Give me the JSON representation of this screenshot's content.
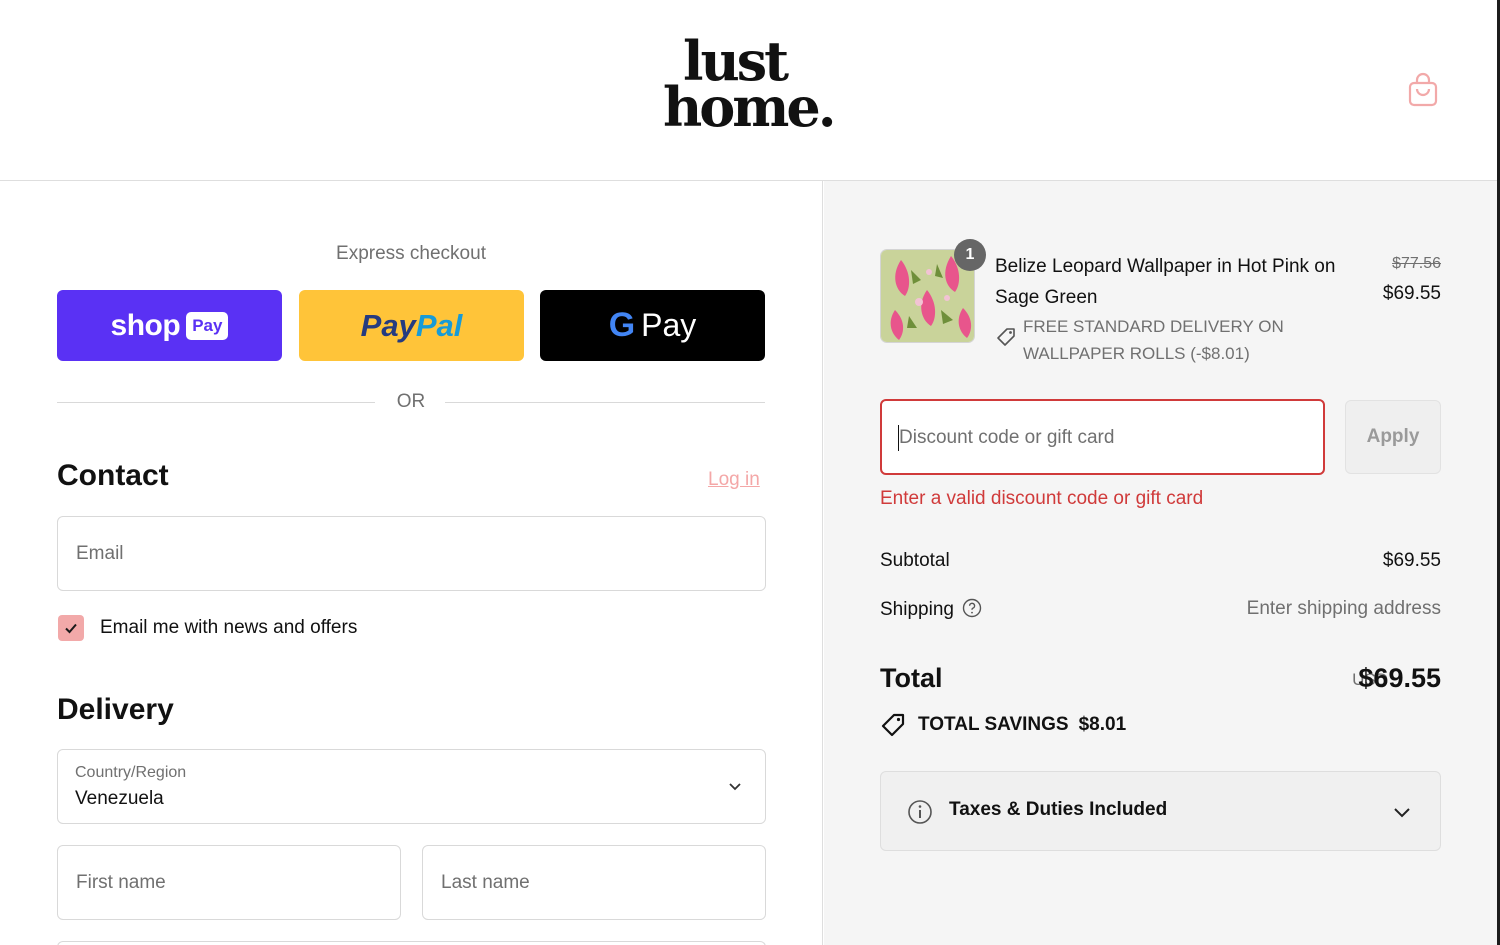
{
  "brand": {
    "logo_line1": "lust",
    "logo_line2": "home."
  },
  "header": {
    "cart_icon": "shopping-bag-icon"
  },
  "express": {
    "title": "Express checkout",
    "shop_pay": {
      "text": "shop",
      "badge": "Pay",
      "color": "#5a31f4"
    },
    "paypal": {
      "part1": "Pay",
      "part2": "Pal",
      "color": "#ffc439"
    },
    "gpay": {
      "g": "G",
      "text": "Pay",
      "color": "#000000"
    },
    "or": "OR"
  },
  "contact": {
    "title": "Contact",
    "login": "Log in",
    "email_placeholder": "Email",
    "news_checked": true,
    "news_label": "Email me with news and offers"
  },
  "delivery": {
    "title": "Delivery",
    "country_label": "Country/Region",
    "country_value": "Venezuela",
    "first_name_placeholder": "First name",
    "last_name_placeholder": "Last name"
  },
  "order": {
    "item": {
      "quantity": "1",
      "title": "Belize Leopard Wallpaper in Hot Pink on Sage Green",
      "original_price": "$77.56",
      "price": "$69.55",
      "discount": "FREE STANDARD DELIVERY ON WALLPAPER ROLLS (-$8.01)"
    },
    "discount_placeholder": "Discount code or gift card",
    "apply": "Apply",
    "error": "Enter a valid discount code or gift card",
    "subtotal_label": "Subtotal",
    "subtotal_value": "$69.55",
    "shipping_label": "Shipping",
    "shipping_value": "Enter shipping address",
    "total_label": "Total",
    "currency": "USD",
    "total_value": "$69.55",
    "savings_label": "TOTAL SAVINGS",
    "savings_value": "$8.01",
    "taxes": "Taxes & Duties Included"
  },
  "colors": {
    "accent": "#f2a9a9",
    "error": "#d03a3a",
    "sidebar_bg": "#f5f5f5"
  }
}
